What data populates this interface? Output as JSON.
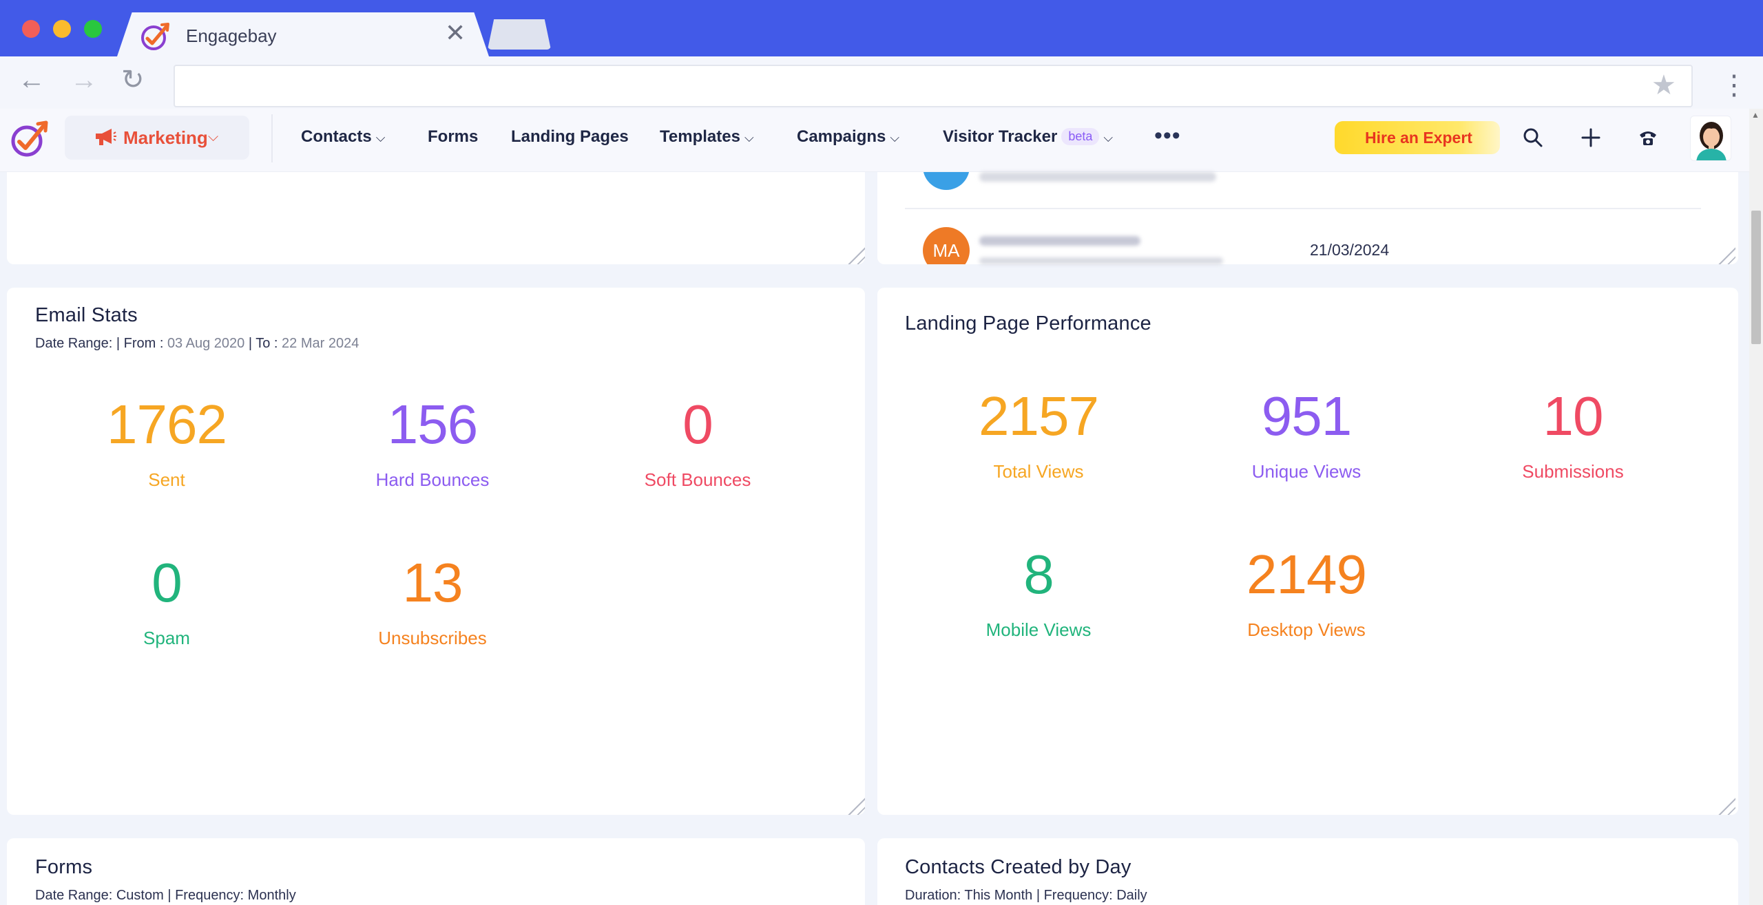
{
  "browser": {
    "tab_title": "Engagebay",
    "close_glyph": "✕",
    "back_glyph": "←",
    "forward_glyph": "→",
    "reload_glyph": "↻",
    "star_glyph": "★",
    "menu_glyph": "⋮"
  },
  "header": {
    "module_label": "Marketing",
    "caret": "⌵",
    "nav": [
      {
        "label": "Contacts",
        "has_dropdown": true
      },
      {
        "label": "Forms",
        "has_dropdown": false
      },
      {
        "label": "Landing Pages",
        "has_dropdown": false
      },
      {
        "label": "Templates",
        "has_dropdown": true
      },
      {
        "label": "Campaigns",
        "has_dropdown": true
      },
      {
        "label": "Visitor Tracker",
        "badge": "beta",
        "has_dropdown": true
      }
    ],
    "more_glyph": "•••",
    "hire_label": "Hire an Expert",
    "icons": [
      "search-icon",
      "plus-icon",
      "phone-icon",
      "avatar"
    ]
  },
  "contacts_fragment": {
    "avatar_initials": "MA",
    "date": "21/03/2024"
  },
  "email_stats": {
    "title": "Email Stats",
    "subtitle_prefix": "Date Range: | From : ",
    "from": "03 Aug 2020",
    "to_prefix": " | To : ",
    "to": "22 Mar 2024",
    "stats": [
      {
        "value": "1762",
        "label": "Sent",
        "color": "#f6a623"
      },
      {
        "value": "156",
        "label": "Hard Bounces",
        "color": "#8c5cf0"
      },
      {
        "value": "0",
        "label": "Soft Bounces",
        "color": "#ef4a63"
      },
      {
        "value": "0",
        "label": "Spam",
        "color": "#21b47c"
      },
      {
        "value": "13",
        "label": "Unsubscribes",
        "color": "#f5821f"
      }
    ]
  },
  "landing_perf": {
    "title": "Landing Page Performance",
    "stats": [
      {
        "value": "2157",
        "label": "Total Views",
        "color": "#f6a623"
      },
      {
        "value": "951",
        "label": "Unique Views",
        "color": "#8c5cf0"
      },
      {
        "value": "10",
        "label": "Submissions",
        "color": "#ef4a63"
      },
      {
        "value": "8",
        "label": "Mobile Views",
        "color": "#21b47c"
      },
      {
        "value": "2149",
        "label": "Desktop Views",
        "color": "#f5821f"
      }
    ]
  },
  "forms_card": {
    "title": "Forms",
    "subtitle": "Date Range: Custom | Frequency: Monthly"
  },
  "contacts_day_card": {
    "title": "Contacts Created by Day",
    "subtitle": "Duration: This Month | Frequency: Daily"
  }
}
